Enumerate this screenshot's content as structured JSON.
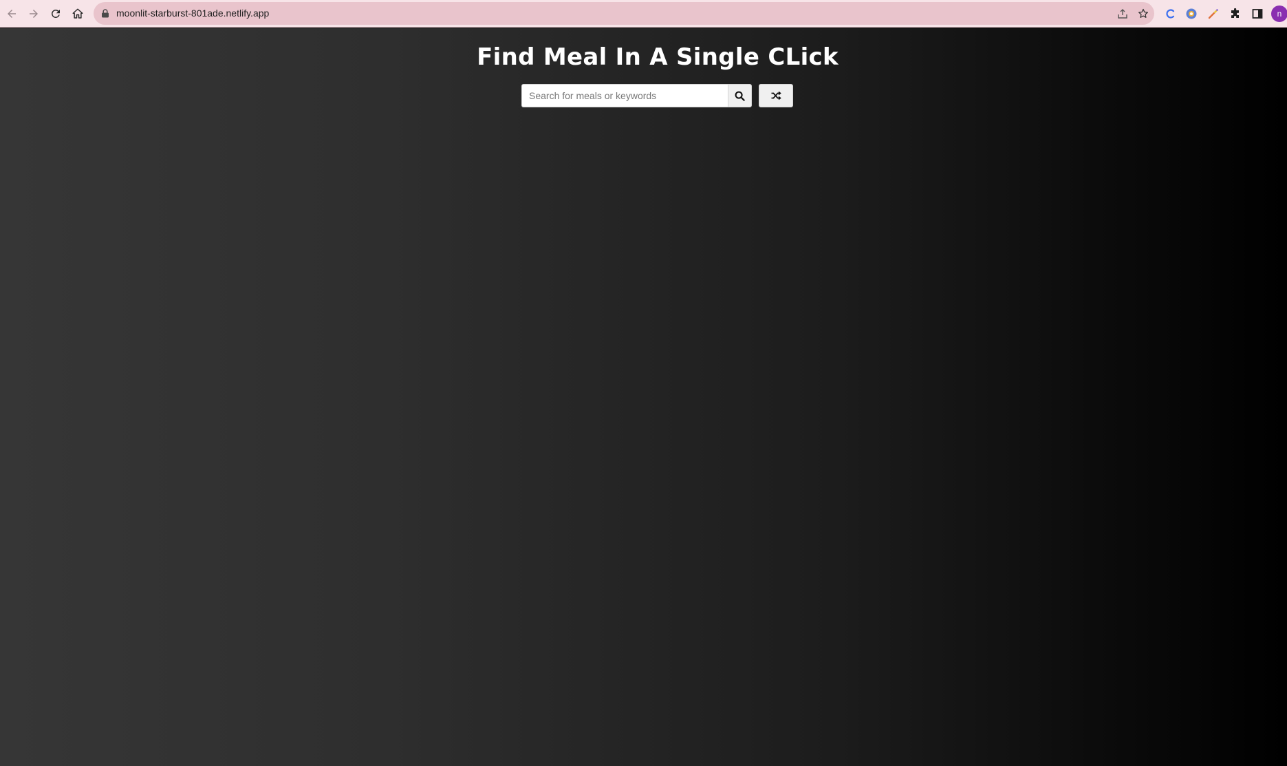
{
  "browser": {
    "url": "moonlit-starburst-801ade.netlify.app",
    "profile_initial": "n",
    "icons": {
      "back": "back-arrow-icon",
      "forward": "forward-arrow-icon",
      "reload": "reload-icon",
      "home": "home-icon",
      "lock": "lock-icon",
      "share": "share-icon",
      "bookmark": "star-icon",
      "extensions": [
        "c-extension-icon",
        "chrome-extension-icon",
        "color-picker-extension-icon",
        "puzzle-icon",
        "side-panel-icon"
      ]
    },
    "colors": {
      "toolbar": "#f7e4e8",
      "omnibox": "#e9c4cc",
      "avatar": "#8a2fb0"
    }
  },
  "page": {
    "title": "Find Meal In A Single CLick",
    "search": {
      "placeholder": "Search for meals or keywords",
      "value": ""
    },
    "search_button_icon": "search-icon",
    "random_button_icon": "shuffle-icon",
    "colors": {
      "background_start": "#363636",
      "background_end": "#000000",
      "title": "#ffffff"
    }
  }
}
